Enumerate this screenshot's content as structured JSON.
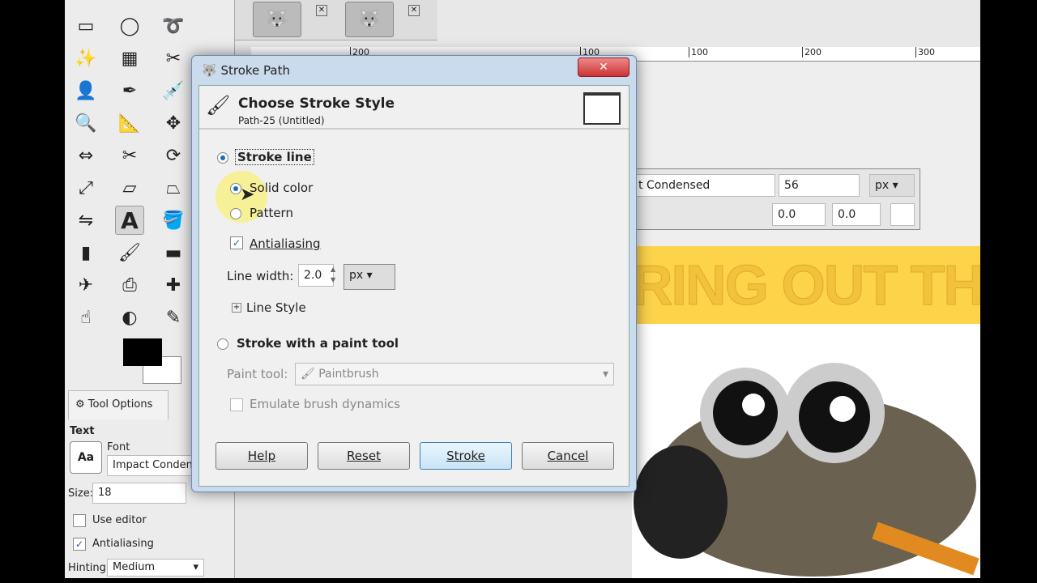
{
  "toolbox": {
    "tools": [
      "rect-select",
      "ellipse-select",
      "free-select",
      "fuzzy-select",
      "select-by-color",
      "scissors",
      "foreground-select",
      "paths",
      "color-picker",
      "zoom",
      "measure",
      "move",
      "align",
      "crop",
      "rotate",
      "scale",
      "shear",
      "perspective",
      "flip",
      "text",
      "bucket-fill",
      "blend",
      "paintbrush",
      "eraser",
      "airbrush",
      "clone",
      "heal",
      "smudge",
      "dodge-burn",
      "ink"
    ],
    "fg_color": "#000000",
    "bg_color": "#ffffff",
    "tab_label": "Tool Options",
    "section": "Text",
    "font_label": "Font",
    "font_value": "Impact Conden",
    "aa_icon": "Aa",
    "size_label": "Size:",
    "size_value": "18",
    "use_editor": "Use editor",
    "antialiasing": "Antialiasing",
    "hinting_label": "Hinting:",
    "hinting_value": "Medium"
  },
  "canvas": {
    "ruler_ticks": [
      "100",
      "200",
      "300"
    ],
    "dialog_ruler_ticks": [
      "200",
      "100"
    ],
    "text_toolbar": {
      "font": "t Condensed",
      "size": "56",
      "unit": "px",
      "baseline": "0.0",
      "kerning": "0.0"
    },
    "banner_text": "RING OUT THE C",
    "banner_color": "#fdd34a"
  },
  "dialog": {
    "title": "Stroke Path",
    "heading": "Choose Stroke Style",
    "subheading": "Path-25 (Untitled)",
    "stroke_line": "Stroke line",
    "solid_color": "Solid color",
    "pattern": "Pattern",
    "antialiasing": "Antialiasing",
    "line_width_label": "Line width:",
    "line_width_value": "2.0",
    "unit": "px",
    "line_style": "Line Style",
    "stroke_paint_tool": "Stroke with a paint tool",
    "paint_tool_label": "Paint tool:",
    "paint_tool_value": "Paintbrush",
    "emulate": "Emulate brush dynamics",
    "buttons": {
      "help": "Help",
      "reset": "Reset",
      "stroke": "Stroke",
      "cancel": "Cancel"
    }
  }
}
